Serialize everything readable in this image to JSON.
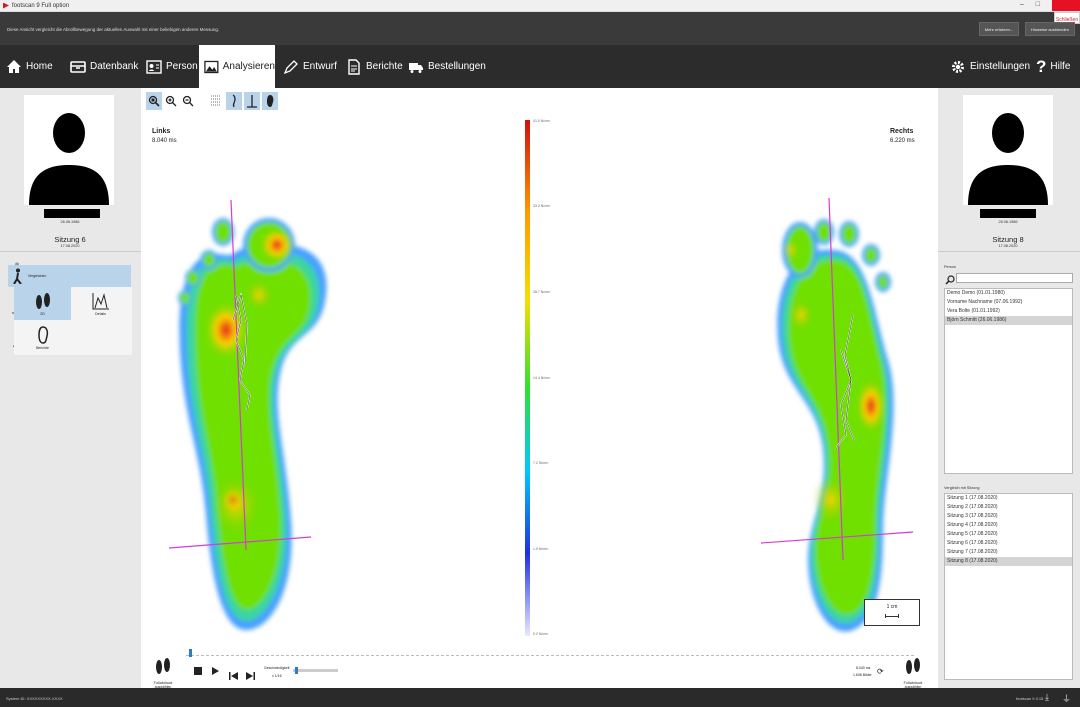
{
  "window": {
    "title": "footscan 9 Full option",
    "close_tab": "Schließen"
  },
  "notification": {
    "message": "Diese Ansicht vergleicht die Abrollbewegung der aktuellen Auswahl mit einer beliebigen anderen Messung.",
    "more_button": "Mehr erfahren...",
    "dismiss_button": "Hinweise ausblenden"
  },
  "nav": {
    "home": "Home",
    "datenbank": "Datenbank",
    "person": "Person",
    "analysieren": "Analysieren",
    "entwurf": "Entwurf",
    "berichte": "Berichte",
    "bestellungen": "Bestellungen",
    "einstellungen": "Einstellungen",
    "hilfe": "Hilfe"
  },
  "left_panel": {
    "dob": "26.06.1986",
    "session_title": "Sitzung 6",
    "session_date": "17.08.2020",
    "items": [
      "3D-Scan",
      "Statisch",
      "Balance",
      "Dynamisch"
    ],
    "compare_label": "Vergleichen",
    "tiles": {
      "tile_2d": "2D",
      "tile_details": "Details",
      "tile_berichte": "Berichte"
    }
  },
  "right_panel": {
    "dob": "26.06.1986",
    "session_title": "Sitzung 8",
    "session_date": "17.08.2020",
    "person_label": "Person",
    "persons": [
      "Demo Demo (01.01.1980)",
      "Vorname Nachname (07.06.1992)",
      "Vera  Bolte (01.01.1992)",
      "Björn Schmitt (26.06.1986)"
    ],
    "selected_person_index": 3,
    "compare_label": "Vergleich mit Sitzung",
    "sessions": [
      "Sitzung 1 (17.08.2020)",
      "Sitzung 2 (17.08.2020)",
      "Sitzung 3 (17.08.2020)",
      "Sitzung 4 (17.08.2020)",
      "Sitzung 5 (17.08.2020)",
      "Sitzung 6 (17.08.2020)",
      "Sitzung 7 (17.08.2020)",
      "Sitzung 8 (17.08.2020)"
    ],
    "selected_session_index": 7
  },
  "main": {
    "left_foot": {
      "label": "Links",
      "time": "8.040 ms"
    },
    "right_foot": {
      "label": "Rechts",
      "time": "6.220 ms"
    },
    "scale_ticks": [
      "41.0 N/cm²",
      "33.2 N/cm²",
      "28.7 N/cm²",
      "14.4 N/cm²",
      "7.2 N/cm²",
      "1.9 N/cm²",
      "0.2 N/cm²"
    ],
    "scale_box_label": "1 cm",
    "playback": {
      "left_caption": "Fußabdruck auswählen",
      "right_caption": "Fußabdruck auswählen",
      "speed_label": "Geschwindigkeit",
      "speed_value": "x 1/16",
      "time_value": "8.040 ms",
      "frames_value": "1.608 Bilder"
    }
  },
  "status": {
    "system_id": "System ID: XXXXXXXXX-XXXX",
    "version": "footscan 9.3.15"
  }
}
